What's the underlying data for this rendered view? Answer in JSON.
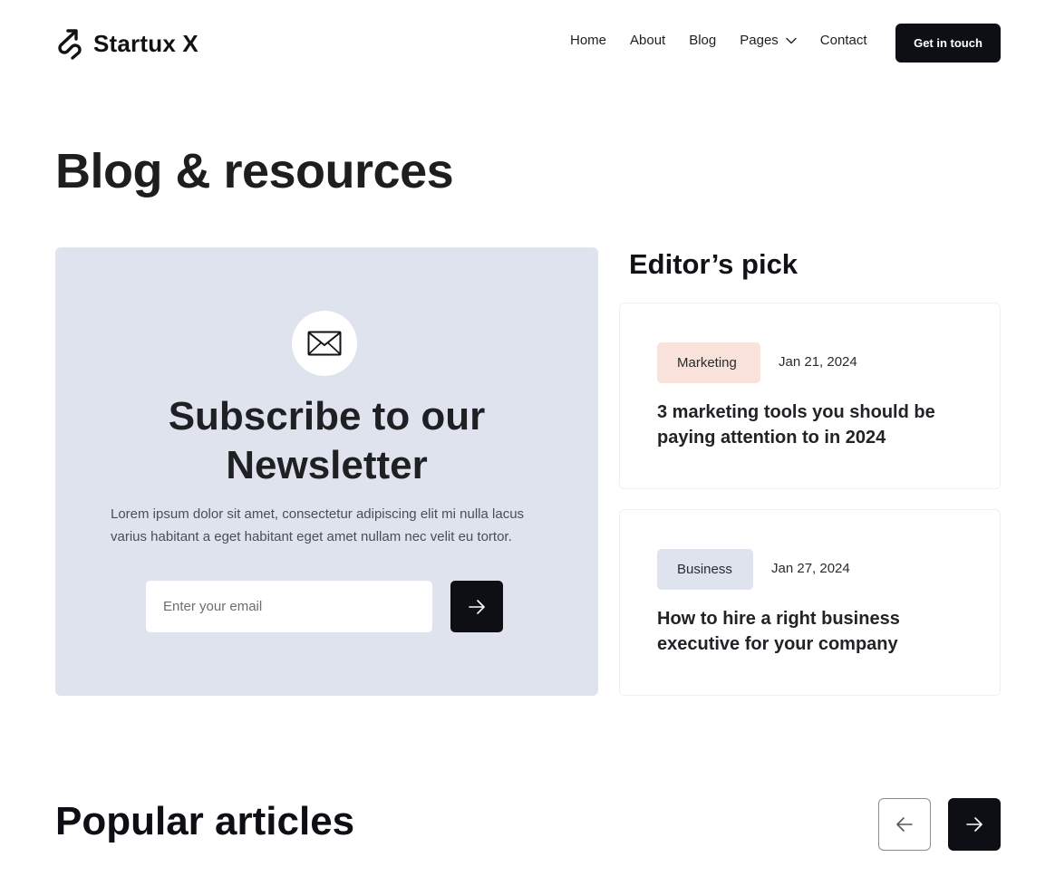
{
  "header": {
    "brand": "Startux X",
    "nav": [
      {
        "label": "Home"
      },
      {
        "label": "About"
      },
      {
        "label": "Blog"
      },
      {
        "label": "Pages",
        "icon": "chevron-down-icon"
      },
      {
        "label": "Contact"
      }
    ],
    "cta_label": "Get in touch"
  },
  "page": {
    "title": "Blog & resources"
  },
  "newsletter": {
    "icon": "envelope-icon",
    "title_line1": "Subscribe to our",
    "title_line2": "Newsletter",
    "description": "Lorem ipsum dolor sit amet, consectetur adipiscing elit mi nulla lacus varius habitant a eget habitant eget amet nullam nec velit eu tortor.",
    "email_placeholder": "Enter your email",
    "email_value": "",
    "submit_icon": "arrow-right-icon"
  },
  "editors_pick": {
    "title": "Editor’s pick",
    "articles": [
      {
        "tag": "Marketing",
        "tag_color": "#f9e2d9",
        "date": "Jan 21, 2024",
        "title": "3 marketing tools you should be paying attention to in 2024"
      },
      {
        "tag": "Business",
        "tag_color": "#dee3ed",
        "date": "Jan 27, 2024",
        "title": "How to hire a right business executive for your company"
      }
    ]
  },
  "popular": {
    "title": "Popular articles",
    "prev_icon": "arrow-left-icon",
    "next_icon": "arrow-right-icon"
  },
  "colors": {
    "primary_dark": "#0d0f14",
    "newsletter_bg": "#dee3ed",
    "marketing_tag": "#f9e2d9",
    "business_tag": "#dee3ed"
  }
}
